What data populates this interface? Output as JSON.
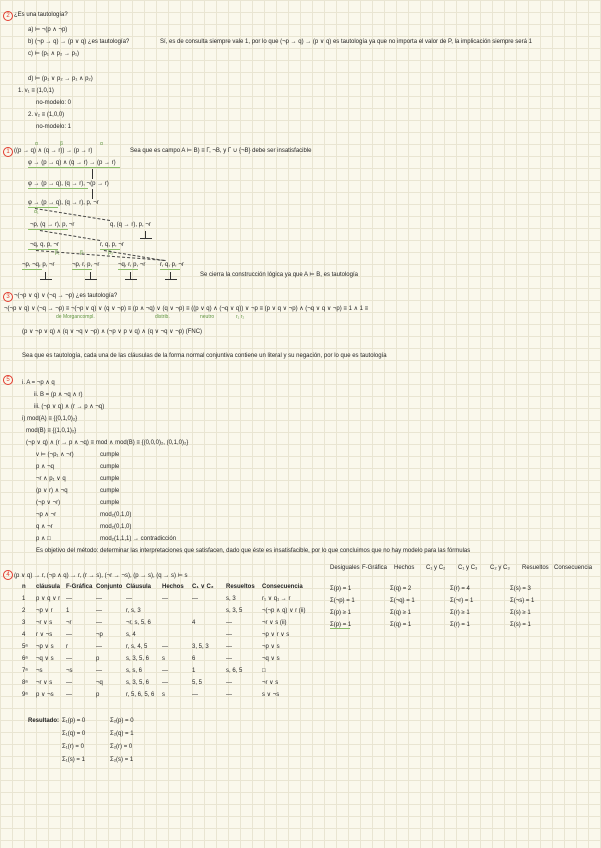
{
  "section_numbers": [
    "2",
    "1",
    "3",
    "5",
    "4"
  ],
  "lines": [
    "¿Es una tautología?",
    "a) ⊨ ¬(p ∧ ¬p)",
    "b) (¬p → q) → (p ∨ q) ¿es tautología?",
    "Sí, es de consulta siempre vale 1, por lo que (¬p → q) → (p ∨ q) es tautología ya que no importa el valor de P, la implicación siempre será 1",
    "c) ⊨ (p₁ ∧ p₂ → p₁)",
    "d) ⊨ (p₁ ∨ p₂ → p₁ ∧ p₂)",
    "1. v₁ ≡ (1,0,1)",
    "no-modelo: 0",
    "2. v₂ ≡ (1,0,0)",
    "no-modelo: 1",
    "((p → q) ∧ (q → r)) → (p → r)",
    "Sea que es campo A ⊨ B) ≡ Γ, ¬B, y Γ ∪ {¬B} debe ser insatisfacible",
    "φ → (p → q) ∧ (q → r) → (p → r)",
    "φ → (p → q), (q → r), ¬(p → r)",
    "φ → (p → q), (q → r), p, ¬r",
    "¬p, (q → r), p, ¬r",
    "q, (q → r), p, ¬r",
    "¬q, q, p, ¬r",
    "r, q, p, ¬r",
    "¬p, ¬q, p, ¬r",
    "¬p, r, p, ¬r",
    "¬q, r, p, ¬r",
    "r, q, p, ¬r",
    "Se cierra la construcción lógica ya que A ⊨ B, es tautología",
    "¬(¬p ∨ q) ∨ (¬q → ¬p) ¿es tautología?",
    "¬(¬p ∨ q) ∨ (¬q → ¬p) ≡ ¬(¬p ∨ q) ∨ (q ∨ ¬p) ≡ (p ∧ ¬q) ∨ (q ∨ ¬p) ≡ ((p ∨ q) ∧ (¬q ∨ q)) ∨ ¬p ≡ (p ∨ q ∨ ¬p) ∧ (¬q ∨ q ∨ ¬p) ≡ 1 ∧ 1 ≡",
    "(p ∨ ¬p ∨ q) ∧ (q ∨ ¬q ∨ ¬p) ∧ (¬p ∨ p ∨ q) ∧ (q ∨ ¬q ∨ ¬p)   (FNC)",
    "Sea que es tautología, cada una de las cláusulas de la forma normal conjuntiva contiene un literal y su negación, por lo que es tautología",
    "i.   A = ¬p ∧ q",
    "ii.  B = (p ∧ ¬q ∧ r)",
    "iii. (¬p ∨ q) ∧ (r → p ∧ ¬q)",
    "i)  mod(A) ≡ {(0,1,0)₂}",
    "mod(B) ≡ {(1,0,1)₂}",
    "(¬p ∨ q) ∧ (r → p ∧ ¬q) ≡ mod ∧ mod(B) ≡ {(0,0,0)₂, (0,1,0)₂}",
    "v ⊨ (¬p₁ ∧ ¬r)",
    "cumple",
    "p ∧ ¬q",
    "cumple",
    "¬r ∧ p₁ ∨ q",
    "cumple",
    "(p ∨ r) ∧ ¬q",
    "cumple",
    "(¬p ∨ ¬r)",
    "cumple",
    "¬p ∧ ¬r",
    "mod₂(0,1,0)",
    "q ∧ ¬r",
    "mod₂(0,1,0)",
    "p ∧ □",
    "mod₂(1,1,1) → contradicción",
    "Es objetivo del método: determinar las interpretaciones que satisfacen, dado que éste es insatisfacible, por lo que concluimos que no hay modelo para las fórmulas",
    "(p ∨ q) → r, (¬p ∧ q) → r, (r → s), (¬r → ¬s), (p → s), (q → s) ⊨ s",
    "Desiguales",
    "F-Gráfica",
    "Hechos",
    "C₁ y C₂",
    "C₁ y C₃",
    "C₂ y C₃",
    "Resueltos",
    "Consecuencia"
  ],
  "table": {
    "headers": [
      "n",
      "cláusula",
      "F-Gráfica",
      "Conjunto",
      "Cláusula",
      "Hechos",
      "C₁ ∨ C₂",
      "Resueltos",
      "Consecuencia"
    ],
    "rows": [
      [
        "1",
        "p ∨ q ∨ r",
        "—",
        "—",
        "—",
        "—",
        "—",
        "s, 3",
        "r₁ ∨ q₁ → r"
      ],
      [
        "2",
        "¬p ∨ r",
        "1",
        "—",
        "r, s, 3",
        "",
        "",
        "s, 3, 5",
        "¬(¬p ∧ q) ∨ r (ii)"
      ],
      [
        "3",
        "¬r ∨ s",
        "¬r",
        "—",
        "¬r, s, 5, 6",
        "",
        "4",
        "—",
        "¬r ∨ s (ii)"
      ],
      [
        "4",
        "r ∨ ¬s",
        "—",
        "¬p",
        "s, 4",
        "",
        "",
        "—",
        "¬p ∨ r ∨ s"
      ],
      [
        "5ᵃ",
        "¬p ∨ s",
        "r",
        "—",
        "r, s, 4, 5",
        "—",
        "3, 5, 3",
        "—",
        "¬p ∨ s"
      ],
      [
        "6ᵃ",
        "¬q ∨ s",
        "—",
        "p",
        "s, 3, 5, 6",
        "s",
        "6",
        "—",
        "¬q ∨ s"
      ],
      [
        "7ᵃ",
        "¬s",
        "¬s",
        "—",
        "s, s, 6",
        "—",
        "1",
        "s, 6, 5",
        "□"
      ],
      [
        "8ᵃ",
        "¬r ∨ s",
        "—",
        "¬q",
        "s, 3, 5, 6",
        "—",
        "5, 5",
        "—",
        "¬r ∨ s"
      ],
      [
        "9ᵃ",
        "p ∨ ¬s",
        "—",
        "p",
        "r, 5, 6, 5, 6",
        "s",
        "—",
        "—",
        "s ∨ ¬s"
      ]
    ],
    "side_rows": [
      [
        "Σ(p) = 1",
        "Σ(q) = 2",
        "Σ(r) = 4",
        "Σ(s) = 3"
      ],
      [
        "Σ(¬p) = 1",
        "Σ(¬q) = 1",
        "Σ(¬r) = 1",
        "Σ(¬s) = 1"
      ],
      [
        "Σ(p) ≥ 1",
        "Σ(q) ≥ 1",
        "Σ(r) ≥ 1",
        "Σ(s) ≥ 1"
      ],
      [
        "Σ(p) = 1",
        "Σ(q) = 1",
        "Σ(r) = 1",
        "Σ(s) = 1"
      ]
    ],
    "summary_label": "Resultado:",
    "summary": [
      [
        "Σ₁(p) = 0",
        "Σ₂(p) = 0"
      ],
      [
        "Σ₁(q) = 0",
        "Σ₂(q) = 1"
      ],
      [
        "Σ₁(r) = 0",
        "Σ₂(r) = 0"
      ],
      [
        "Σ₁(s) = 1",
        "Σ₂(s) = 1"
      ]
    ]
  },
  "annotations": [
    "α",
    "β",
    "α",
    "α₁",
    "β₁",
    "β₂",
    "β₃",
    "de Morgan",
    "distrib.",
    "neutro",
    "compl.",
    "r₁ r₂"
  ]
}
